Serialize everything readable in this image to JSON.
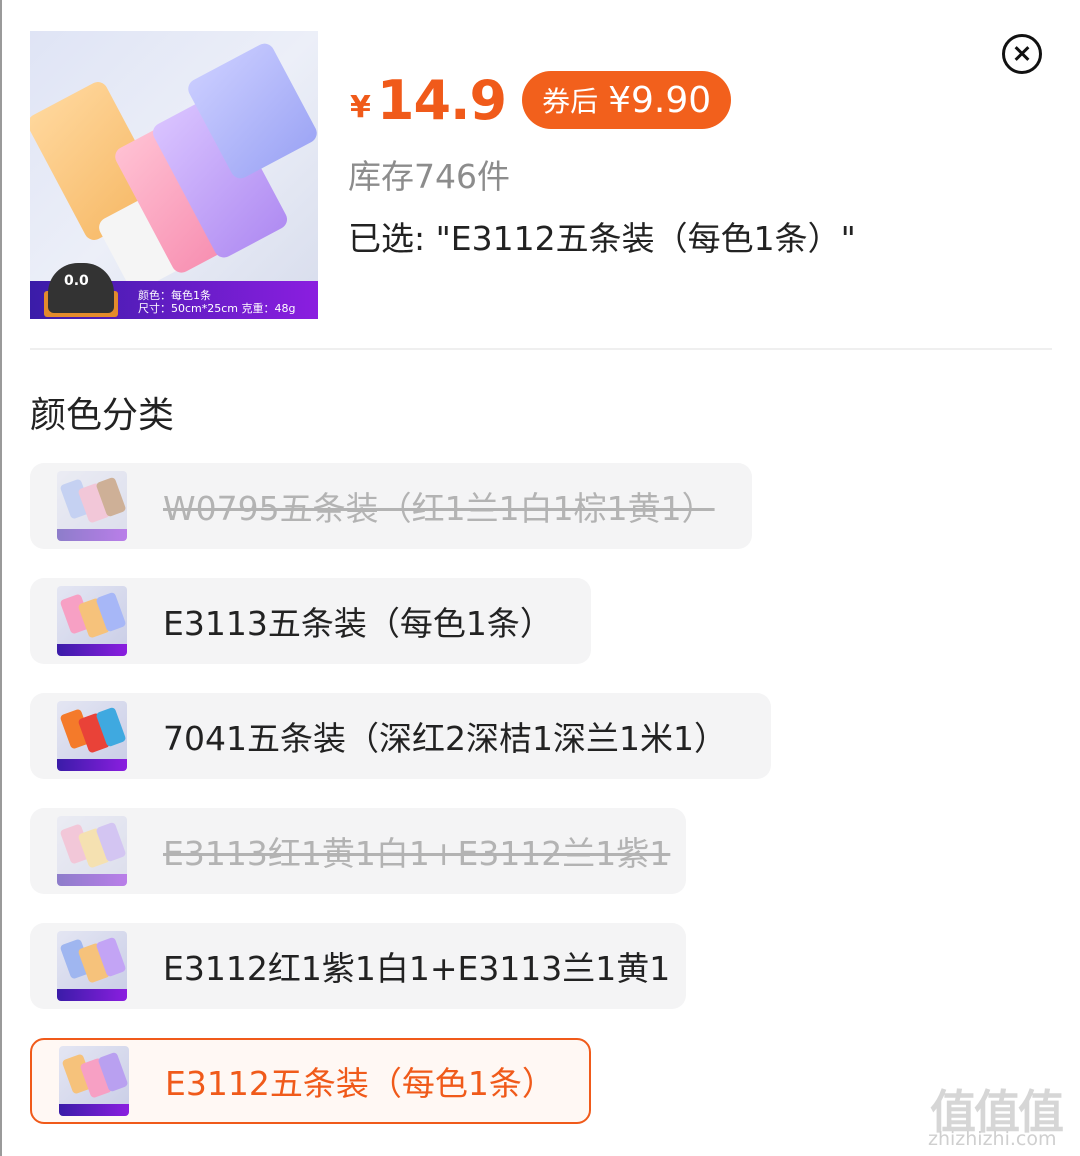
{
  "product": {
    "image_name": "towel-product-image",
    "image_spec_line1": "颜色：每色1条",
    "image_spec_line2": "尺寸：50cm*25cm 克重：48g",
    "mascot_face": "0.0"
  },
  "price": {
    "symbol": "¥",
    "value": "14.9",
    "coupon_label": "券后",
    "coupon_price": "¥9.90"
  },
  "stock_text": "库存746件",
  "selected_text": "已选: \"E3112五条装（每色1条）\"",
  "section_title": "颜色分类",
  "options": [
    {
      "label": "W0795五条装（红1兰1白1棕1黄1）",
      "state": "disabled",
      "thumb_colors": [
        "#9fb6f0",
        "#f2a3c2",
        "#b07a4c"
      ]
    },
    {
      "label": "E3113五条装（每色1条）",
      "state": "available",
      "thumb_colors": [
        "#f7a0c4",
        "#f6c27b",
        "#a7b7f7"
      ]
    },
    {
      "label": "7041五条装（深红2深桔1深兰1米1）",
      "state": "available",
      "thumb_colors": [
        "#f47a2a",
        "#e94238",
        "#3fa9e0"
      ]
    },
    {
      "label": "E3113红1黄1白1+E3112兰1紫1",
      "state": "disabled",
      "thumb_colors": [
        "#f2a3c2",
        "#f6d37b",
        "#b9a0f0"
      ]
    },
    {
      "label": "E3112红1紫1白1+E3113兰1黄1",
      "state": "available",
      "thumb_colors": [
        "#9fb6f0",
        "#f6c27b",
        "#c3a4f5"
      ]
    },
    {
      "label": "E3112五条装（每色1条）",
      "state": "selected",
      "thumb_colors": [
        "#f6c27b",
        "#f7a0c4",
        "#b9a0f0"
      ]
    }
  ],
  "watermark": {
    "logo": "值值值",
    "url": "zhizhizhi.com"
  },
  "colors": {
    "accent": "#f05a1a",
    "muted_text": "#8c8c8c",
    "option_bg": "#f4f4f5"
  }
}
